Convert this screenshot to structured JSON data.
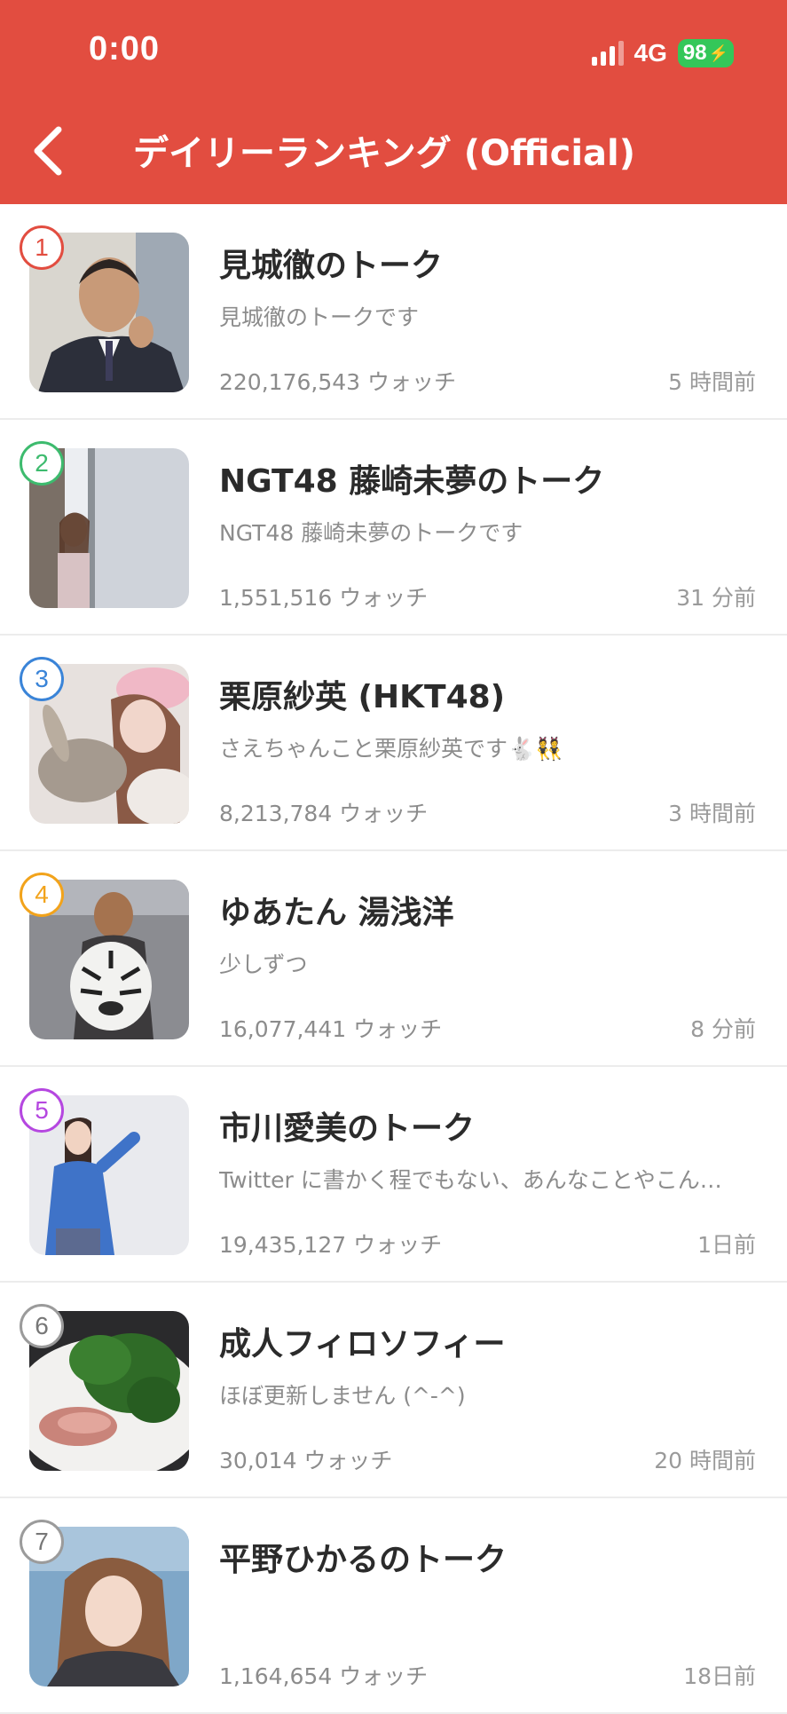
{
  "status_bar": {
    "time": "0:00",
    "network": "4G",
    "battery": "98"
  },
  "header": {
    "title": "デイリーランキング (Official)",
    "back_icon": "chevron-left-icon"
  },
  "colors": {
    "header_bg": "#e24d40",
    "rank_1": "#e24d40",
    "rank_2": "#3dbb6e",
    "rank_3": "#3a84d8",
    "rank_4": "#f2a31b",
    "rank_5": "#b547e0",
    "rank_6": "#9b9b9b",
    "rank_7": "#9b9b9b"
  },
  "items": [
    {
      "rank": "1",
      "name": "見城徹のトーク",
      "description": "見城徹のトークです",
      "watch": "220,176,543 ウォッチ",
      "ago": "5 時間前"
    },
    {
      "rank": "2",
      "name": "NGT48 藤崎未夢のトーク",
      "description": "NGT48 藤崎未夢のトークです",
      "watch": "1,551,516 ウォッチ",
      "ago": "31 分前"
    },
    {
      "rank": "3",
      "name": "栗原紗英 (HKT48)",
      "description": "さえちゃんこと栗原紗英です🐇👯",
      "watch": "8,213,784 ウォッチ",
      "ago": "3 時間前"
    },
    {
      "rank": "4",
      "name": "ゆあたん 湯浅洋",
      "description": "少しずつ",
      "watch": "16,077,441 ウォッチ",
      "ago": "8 分前"
    },
    {
      "rank": "5",
      "name": "市川愛美のトーク",
      "description": "Twitter に書かく程でもない、あんなことやこん…",
      "watch": "19,435,127 ウォッチ",
      "ago": "1日前"
    },
    {
      "rank": "6",
      "name": "成人フィロソフィー",
      "description": "ほぼ更新しません (^-^)",
      "watch": "30,014 ウォッチ",
      "ago": "20 時間前"
    },
    {
      "rank": "7",
      "name": "平野ひかるのトーク",
      "description": "",
      "watch": "1,164,654 ウォッチ",
      "ago": "18日前"
    }
  ]
}
